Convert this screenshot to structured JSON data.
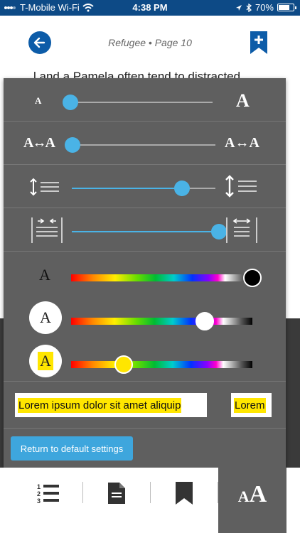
{
  "status_bar": {
    "carrier": "T-Mobile Wi-Fi",
    "time": "4:38 PM",
    "battery": "70%"
  },
  "header": {
    "title": "Refugee • Page 10"
  },
  "book_text": "…l and a Pamela often tend to distracted …",
  "settings": {
    "font_size": {
      "small_label": "A",
      "large_label": "A",
      "value": 0.0
    },
    "letter_spacing": {
      "small_label": "A↔A",
      "large_label": "A↔A",
      "value": 0.0
    },
    "line_height": {
      "value": 0.75
    },
    "margins": {
      "value": 1.0
    },
    "text_color": {
      "label": "A",
      "selected": "#000000"
    },
    "background_color": {
      "label": "A",
      "selected": "#ffffff"
    },
    "highlight_color": {
      "label": "A",
      "selected": "#ffe600"
    },
    "preview_text": "Lorem ipsum dolor sit amet aliquip",
    "preview_small": "Lorem",
    "reset_label": "Return to default settings"
  },
  "toolbar": {
    "items": [
      "table-of-contents",
      "document",
      "bookmarks",
      "text-settings"
    ],
    "text_settings_label": "AA"
  },
  "colors": {
    "status_bar": "#0d4a86",
    "accent": "#4ab3e6",
    "panel": "#5f5f5f",
    "highlight": "#ffe600"
  }
}
